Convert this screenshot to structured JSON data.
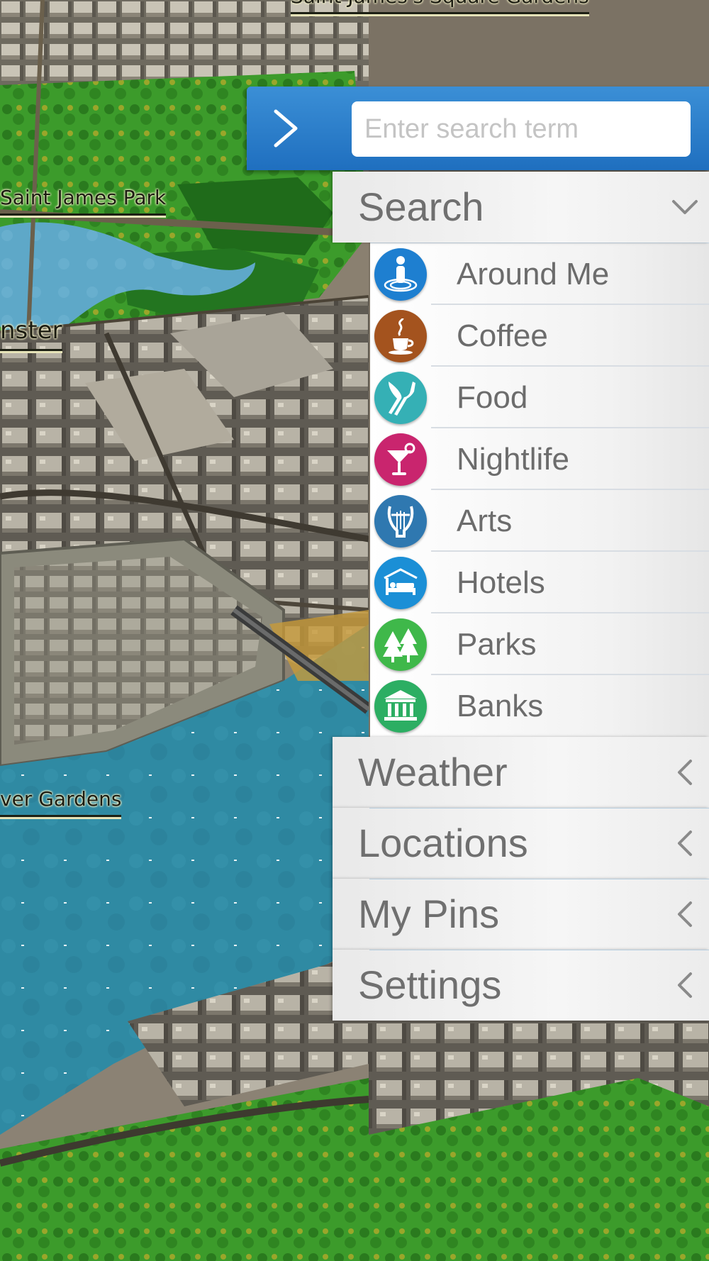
{
  "map": {
    "labels": {
      "top_square": "Saint James's Square Gardens",
      "park": "Saint James Park",
      "westminster": "nster",
      "gardens": "ver Gardens"
    }
  },
  "search": {
    "placeholder": "Enter search term"
  },
  "menu": {
    "search_header": {
      "label": "Search",
      "state": "expanded",
      "icon": "chevron-down-icon"
    },
    "search_items": [
      {
        "label": "Around Me",
        "icon": "person-location-icon",
        "color": "#1e7fd0"
      },
      {
        "label": "Coffee",
        "icon": "coffee-cup-icon",
        "color": "#a4531e"
      },
      {
        "label": "Food",
        "icon": "knife-fork-icon",
        "color": "#35b0b5"
      },
      {
        "label": "Nightlife",
        "icon": "cocktail-icon",
        "color": "#c9256e"
      },
      {
        "label": "Arts",
        "icon": "lyre-icon",
        "color": "#2f78b0"
      },
      {
        "label": "Hotels",
        "icon": "bed-icon",
        "color": "#1b8fd6"
      },
      {
        "label": "Parks",
        "icon": "trees-icon",
        "color": "#3fb84a"
      },
      {
        "label": "Banks",
        "icon": "bank-icon",
        "color": "#2cae63"
      }
    ],
    "sections": [
      {
        "label": "Weather",
        "state": "collapsed",
        "icon": "chevron-left-icon"
      },
      {
        "label": "Locations",
        "state": "collapsed",
        "icon": "chevron-left-icon"
      },
      {
        "label": "My Pins",
        "state": "collapsed",
        "icon": "chevron-left-icon"
      },
      {
        "label": "Settings",
        "state": "collapsed",
        "icon": "chevron-left-icon"
      }
    ]
  }
}
